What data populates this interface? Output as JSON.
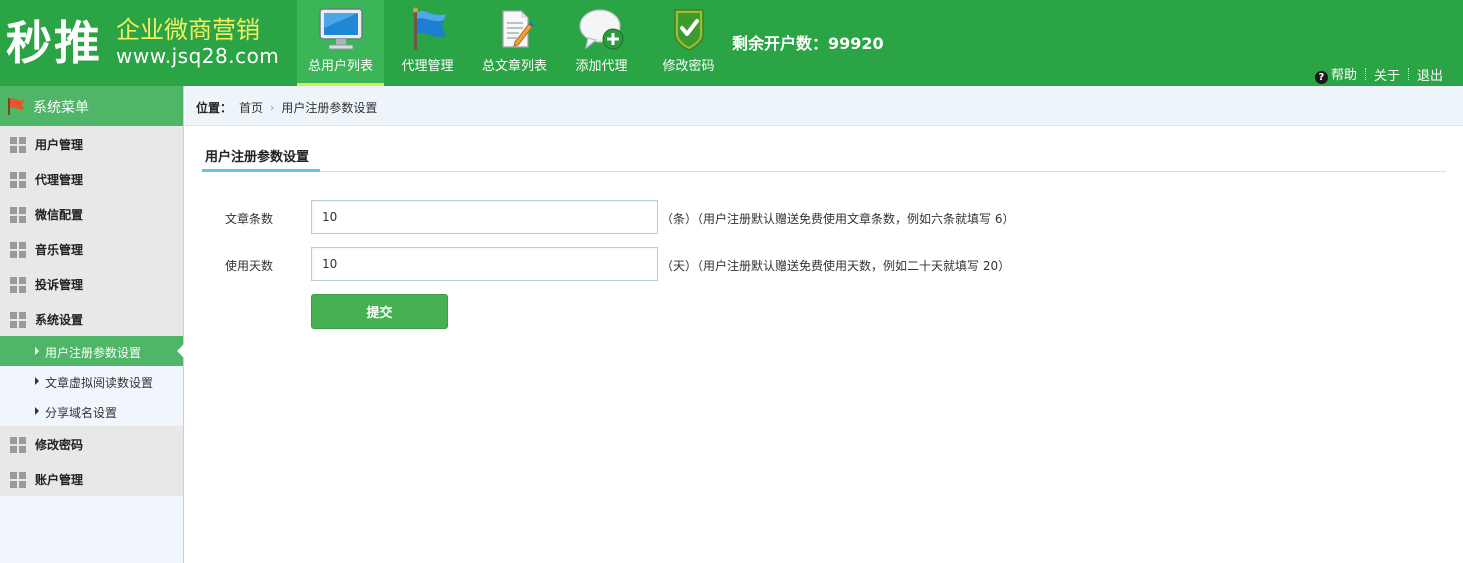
{
  "header": {
    "logo_main": "秒推",
    "logo_sub": "企业微商营销",
    "logo_url": "www.jsq28.com",
    "remaining_label": "剩余开户数：",
    "remaining_value": "99920",
    "links": {
      "help": "帮助",
      "about": "关于",
      "logout": "退出"
    }
  },
  "nav": {
    "items": [
      {
        "label": "总用户列表",
        "icon": "monitor-icon",
        "active": true
      },
      {
        "label": "代理管理",
        "icon": "flag-icon",
        "active": false
      },
      {
        "label": "总文章列表",
        "icon": "document-pen-icon",
        "active": false
      },
      {
        "label": "添加代理",
        "icon": "chat-add-icon",
        "active": false
      },
      {
        "label": "修改密码",
        "icon": "shield-check-icon",
        "active": false
      }
    ]
  },
  "sidebar": {
    "title": "系统菜单",
    "menu": [
      {
        "label": "用户管理"
      },
      {
        "label": "代理管理"
      },
      {
        "label": "微信配置"
      },
      {
        "label": "音乐管理"
      },
      {
        "label": "投诉管理"
      },
      {
        "label": "系统设置"
      }
    ],
    "sub_items": [
      {
        "label": "用户注册参数设置",
        "active": true
      },
      {
        "label": "文章虚拟阅读数设置",
        "active": false
      },
      {
        "label": "分享域名设置",
        "active": false
      }
    ],
    "menu_after": [
      {
        "label": "修改密码"
      },
      {
        "label": "账户管理"
      }
    ]
  },
  "breadcrumb": {
    "position_label": "位置：",
    "home": "首页",
    "current": "用户注册参数设置"
  },
  "main": {
    "tab_title": "用户注册参数设置",
    "fields": [
      {
        "label": "文章条数",
        "value": "10",
        "hint": "（条）（用户注册默认赠送免费使用文章条数，例如六条就填写 6）"
      },
      {
        "label": "使用天数",
        "value": "10",
        "hint": "（天）（用户注册默认赠送免费使用天数，例如二十天就填写 20）"
      }
    ],
    "submit_label": "提交"
  },
  "colors": {
    "header_green": "#2aa444",
    "active_green": "#4fb567",
    "accent_blue": "#67c2dc",
    "logo_yellow": "#f3ef63"
  }
}
